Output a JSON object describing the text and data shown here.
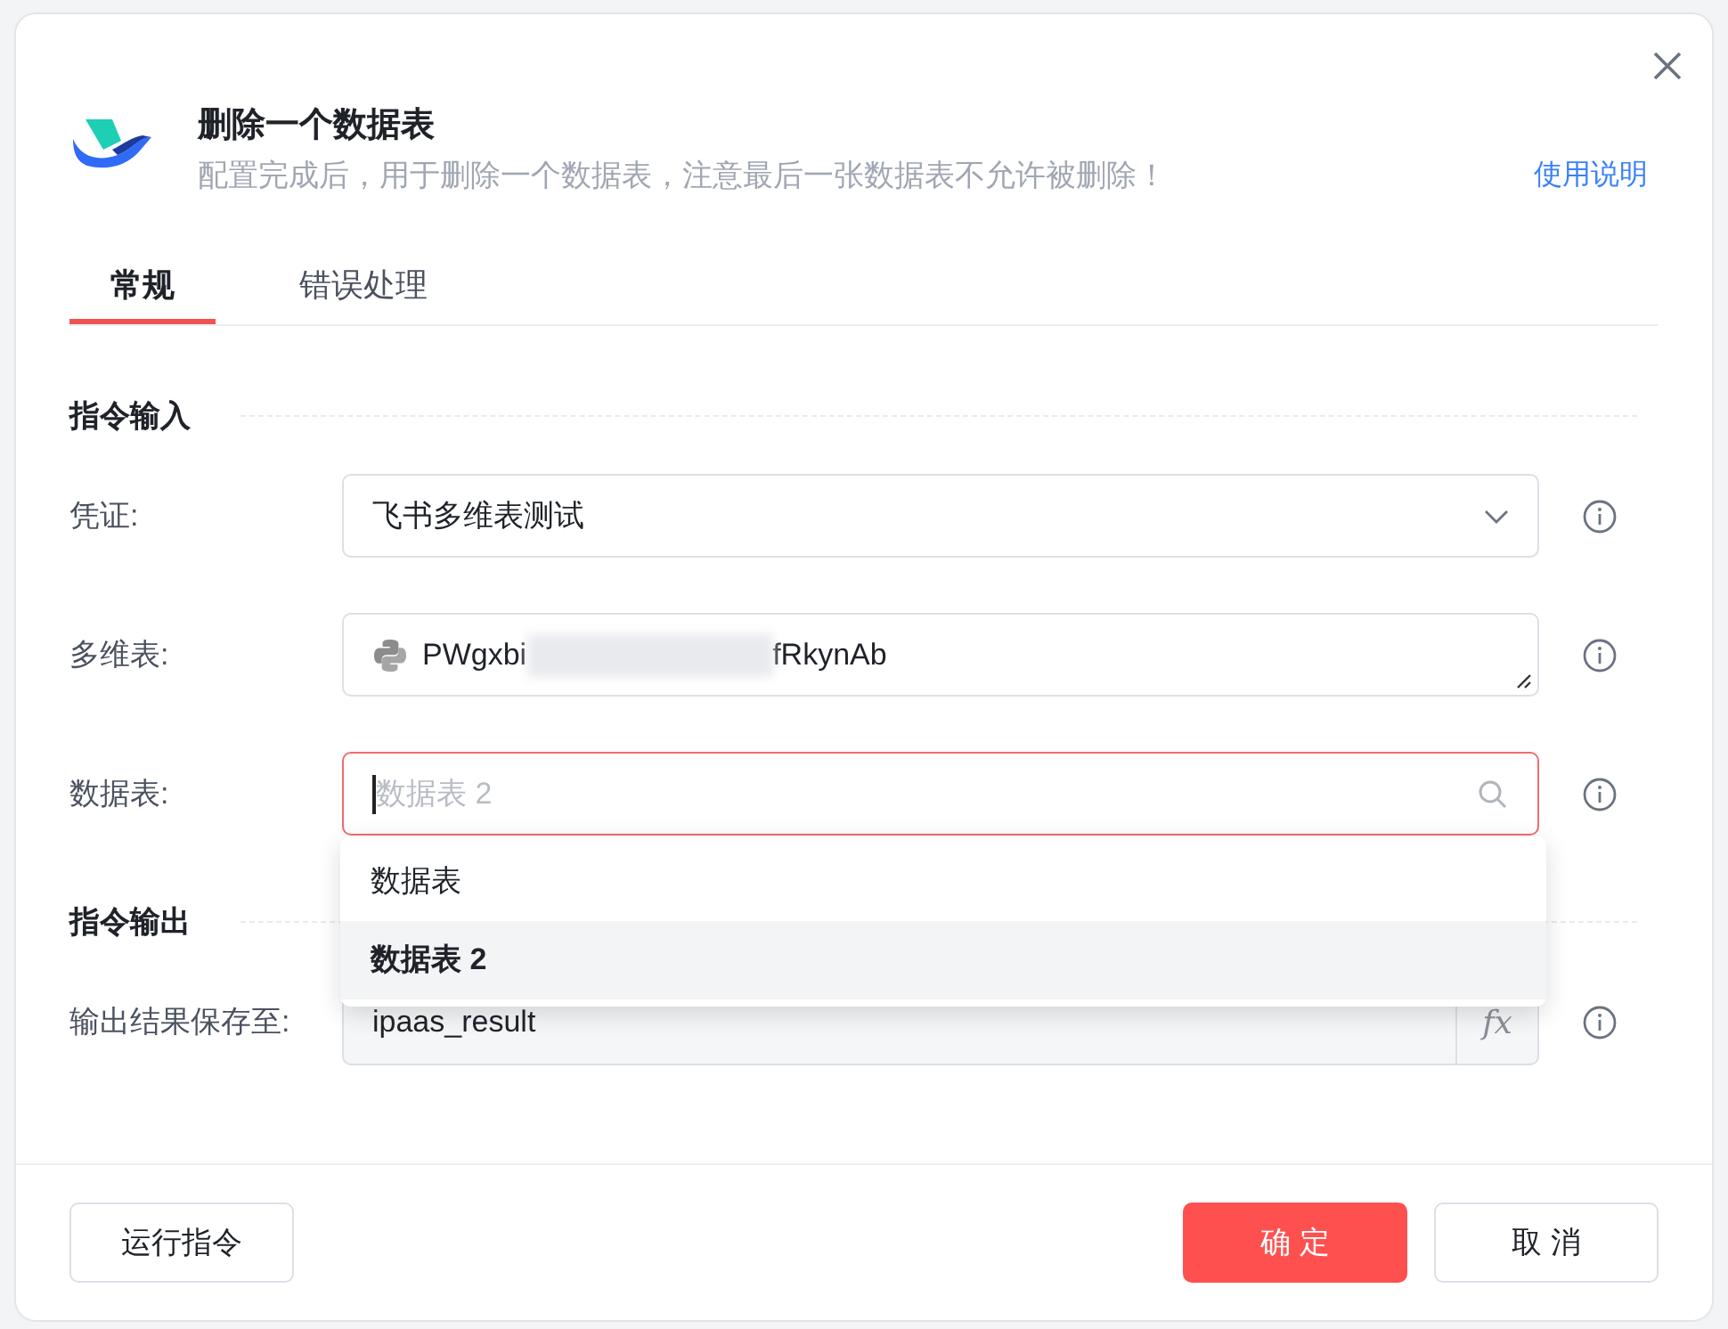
{
  "dialog": {
    "title": "删除一个数据表",
    "subtitle": "配置完成后，用于删除一个数据表，注意最后一张数据表不允许被删除！",
    "help_link": "使用说明"
  },
  "tabs": [
    {
      "label": "常规",
      "selected": true
    },
    {
      "label": "错误处理",
      "selected": false
    }
  ],
  "sections": [
    {
      "title": "指令输入",
      "fields": [
        {
          "kind": "select",
          "label": "凭证:",
          "value": "飞书多维表测试"
        },
        {
          "kind": "code",
          "label": "多维表:",
          "value_start": "PWgxbi",
          "value_end": "fRkynAb"
        },
        {
          "kind": "search",
          "label": "数据表:",
          "placeholder": "数据表 2",
          "focused": true
        }
      ]
    },
    {
      "title": "指令输出",
      "fields": [
        {
          "kind": "variable",
          "label": "输出结果保存至:",
          "value": "ipaas_result",
          "button": "fx"
        }
      ]
    }
  ],
  "dropdown": {
    "options": [
      {
        "label": "数据表",
        "selected": false
      },
      {
        "label": "数据表 2",
        "selected": true
      }
    ]
  },
  "footer": {
    "run_button": "运行指令",
    "ok_button": "确 定",
    "cancel_button": "取 消"
  }
}
